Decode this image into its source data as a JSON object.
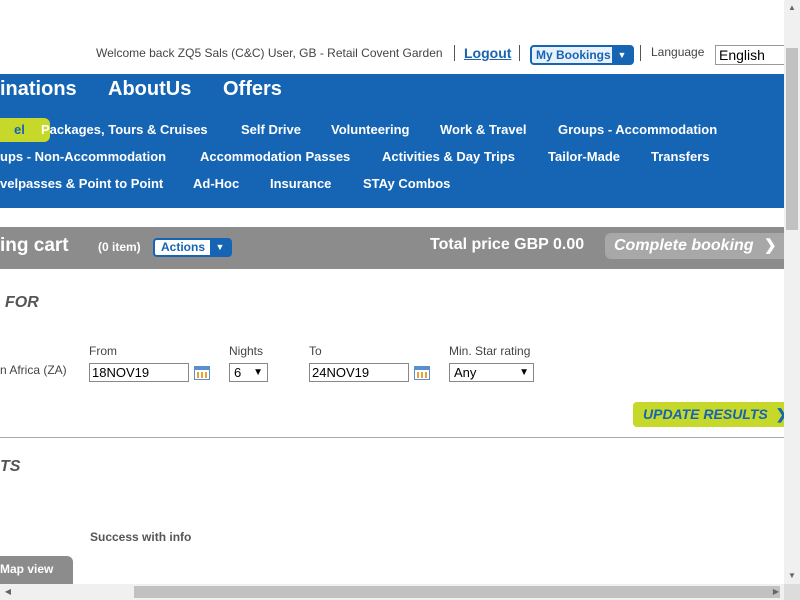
{
  "header": {
    "welcome": "Welcome back ZQ5 Sals (C&C) User, GB - Retail Covent Garden",
    "logout": "Logout",
    "my_bookings": "My Bookings",
    "language_label": "Language",
    "language_value": "English"
  },
  "main_nav": [
    "inations",
    "AboutUs",
    "Offers"
  ],
  "sub_nav": {
    "row1": [
      "el",
      "Packages, Tours & Cruises",
      "Self Drive",
      "Volunteering",
      "Work & Travel",
      "Groups - Accommodation"
    ],
    "row2": [
      "ups - Non-Accommodation",
      "Accommodation Passes",
      "Activities & Day Trips",
      "Tailor-Made",
      "Transfers"
    ],
    "row3": [
      "velpasses & Point to Point",
      "Ad-Hoc",
      "Insurance",
      "STAy Combos"
    ]
  },
  "cart": {
    "title": "ing cart",
    "count": "(0 item)",
    "actions": "Actions",
    "total": "Total price GBP 0.00",
    "complete": "Complete booking"
  },
  "search": {
    "title": "FOR",
    "destination": "n Africa (ZA)",
    "from_label": "From",
    "from_value": "18NOV19",
    "nights_label": "Nights",
    "nights_value": "6",
    "to_label": "To",
    "to_value": "24NOV19",
    "star_label": "Min. Star rating",
    "star_value": "Any",
    "update": "UPDATE RESULTS"
  },
  "results": {
    "title": "TS",
    "status": "Success with info",
    "map_view": "Map view"
  },
  "icons": {
    "dropdown": "chevron-down-icon",
    "calendar": "calendar-icon",
    "arrow": "chevron-right-icon"
  },
  "colors": {
    "brand_blue": "#1565b4",
    "accent_green": "#c6d82a",
    "cart_grey": "#8c8c8c"
  }
}
